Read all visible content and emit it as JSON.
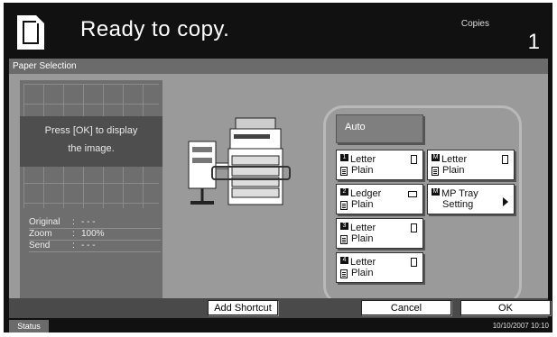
{
  "header": {
    "title": "Ready to copy.",
    "copies_label": "Copies",
    "copies_value": "1"
  },
  "panel": {
    "heading": "Paper Selection"
  },
  "preview": {
    "message_line1": "Press [OK] to display",
    "message_line2": "the image.",
    "info": [
      {
        "key": "Original",
        "value": "- - -"
      },
      {
        "key": "Zoom",
        "value": "100%"
      },
      {
        "key": "Send",
        "value": "- - -"
      }
    ]
  },
  "trays": {
    "auto": "Auto",
    "buttons": [
      {
        "num": "1",
        "size": "Letter",
        "type": "Plain"
      },
      {
        "num": "M",
        "size": "Letter",
        "type": "Plain"
      },
      {
        "num": "2",
        "size": "Ledger",
        "type": "Plain"
      },
      {
        "num": "M",
        "size": "MP Tray",
        "type": "Setting"
      },
      {
        "num": "3",
        "size": "Letter",
        "type": "Plain"
      },
      {
        "num": "4",
        "size": "Letter",
        "type": "Plain"
      }
    ]
  },
  "actions": {
    "add_shortcut": "Add Shortcut",
    "cancel": "Cancel",
    "ok": "OK"
  },
  "status": {
    "tab": "Status",
    "datetime": "10/10/2007  10:10"
  }
}
